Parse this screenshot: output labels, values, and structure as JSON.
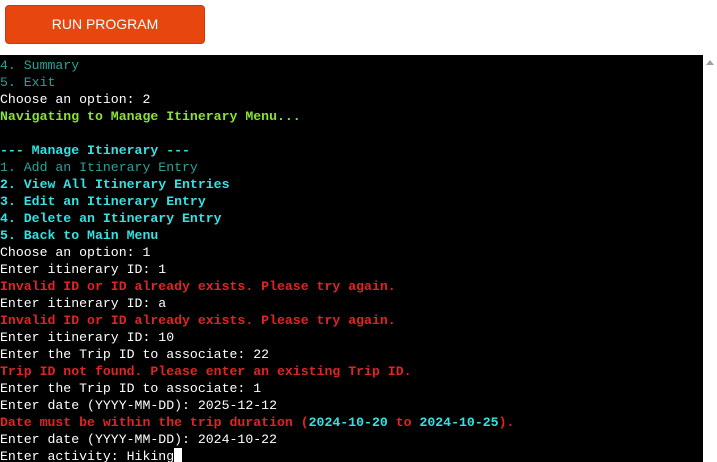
{
  "toolbar": {
    "run_label": "RUN PROGRAM"
  },
  "terminal": {
    "cursor": "block-cursor",
    "lines": [
      {
        "style": "teal",
        "text": "4. Summary"
      },
      {
        "style": "teal",
        "text": "5. Exit"
      },
      {
        "style": "white",
        "text": "Choose an option: 2"
      },
      {
        "style": "green",
        "text": "Navigating to Manage Itinerary Menu..."
      },
      {
        "style": "white",
        "text": ""
      },
      {
        "style": "cyan-b",
        "text": "--- Manage Itinerary ---"
      },
      {
        "style": "teal",
        "text": "1. Add an Itinerary Entry"
      },
      {
        "style": "cyan-b",
        "text": "2. View All Itinerary Entries"
      },
      {
        "style": "cyan-b",
        "text": "3. Edit an Itinerary Entry"
      },
      {
        "style": "cyan-b",
        "text": "4. Delete an Itinerary Entry"
      },
      {
        "style": "cyan-b",
        "text": "5. Back to Main Menu"
      },
      {
        "style": "white",
        "text": "Choose an option: 1"
      },
      {
        "style": "white",
        "text": "Enter itinerary ID: 1"
      },
      {
        "style": "red-b",
        "text": "Invalid ID or ID already exists. Please try again."
      },
      {
        "style": "white",
        "text": "Enter itinerary ID: a"
      },
      {
        "style": "red-b",
        "text": "Invalid ID or ID already exists. Please try again."
      },
      {
        "style": "white",
        "text": "Enter itinerary ID: 10"
      },
      {
        "style": "white",
        "text": "Enter the Trip ID to associate: 22"
      },
      {
        "style": "red-b",
        "text": "Trip ID not found. Please enter an existing Trip ID."
      },
      {
        "style": "white",
        "text": "Enter the Trip ID to associate: 1"
      },
      {
        "style": "white",
        "text": "Enter date (YYYY-MM-DD): 2025-12-12"
      },
      {
        "style": "mixed",
        "segments": [
          {
            "style": "red-b",
            "text": "Date must be within the trip duration ("
          },
          {
            "style": "cyan-b",
            "text": "2024-10-20"
          },
          {
            "style": "red-b",
            "text": " to "
          },
          {
            "style": "cyan-b",
            "text": "2024-10-25"
          },
          {
            "style": "red-b",
            "text": ")."
          }
        ]
      },
      {
        "style": "white",
        "text": "Enter date (YYYY-MM-DD): 2024-10-22"
      },
      {
        "style": "white",
        "text": "Enter activity: Hiking",
        "cursor": true
      }
    ]
  }
}
